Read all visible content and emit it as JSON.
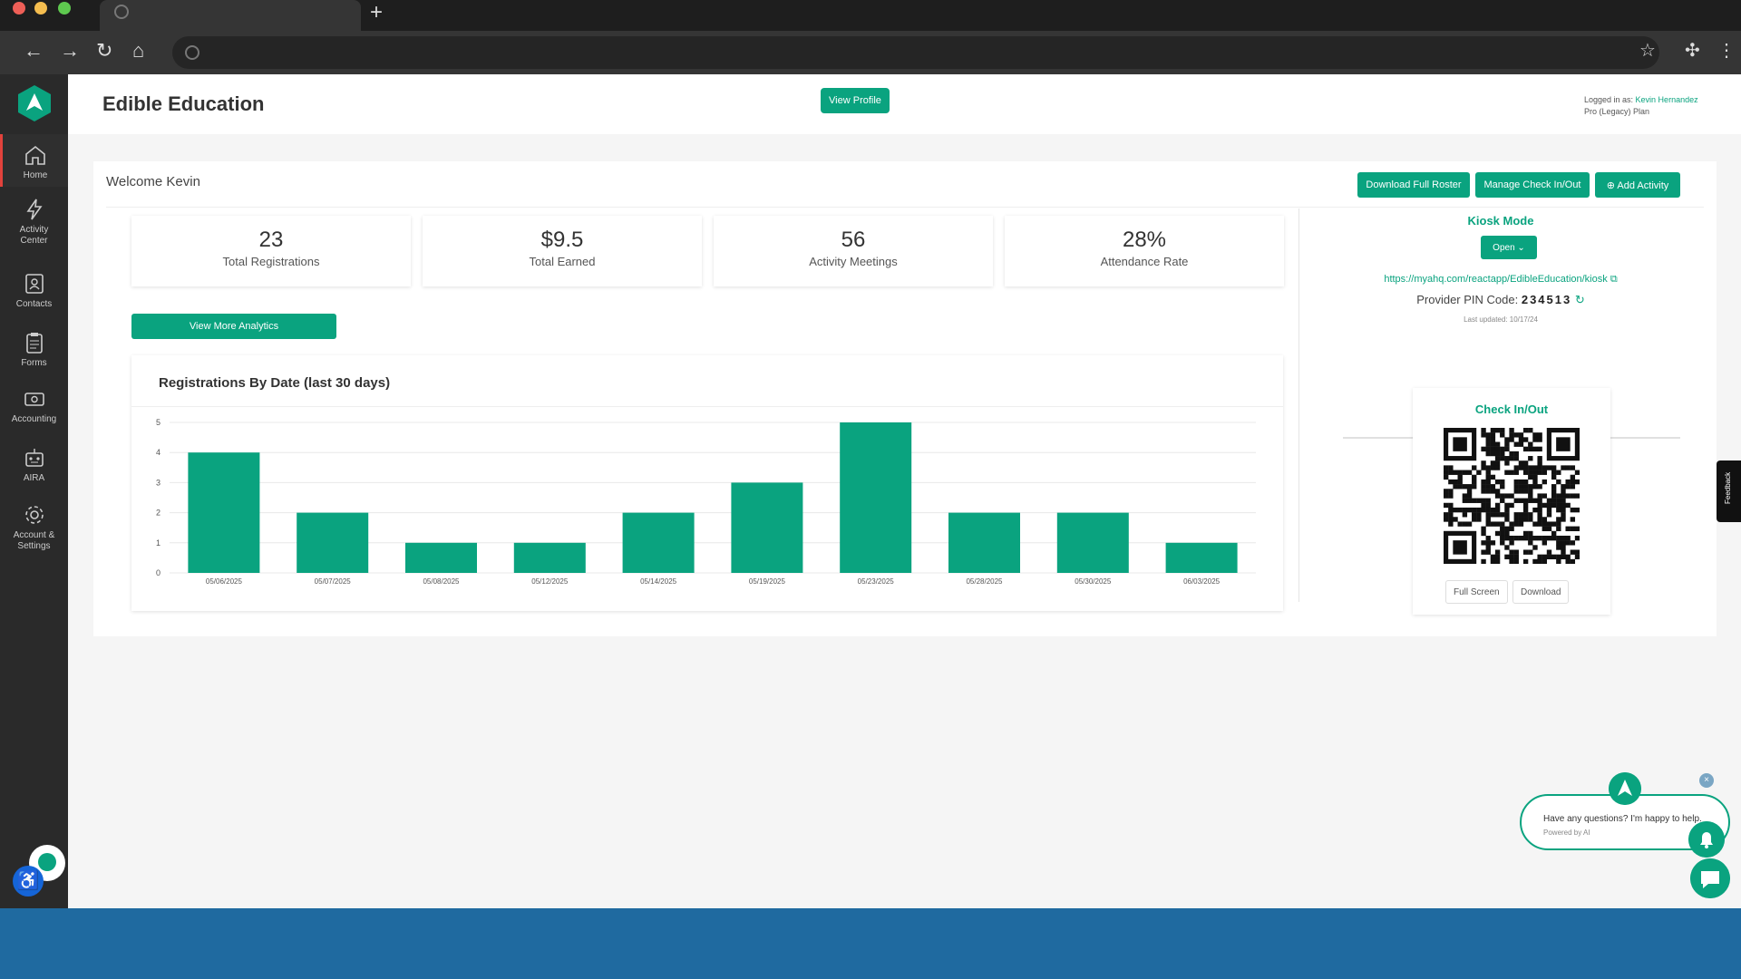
{
  "colors": {
    "accent": "#0aa37f",
    "sidebar": "#2a2a2a",
    "active_marker": "#e2423c"
  },
  "header": {
    "title": "Edible Education",
    "view_profile": "View Profile",
    "logged_in_prefix": "Logged in as: ",
    "user": "Kevin Hernandez",
    "plan": "Pro (Legacy) Plan"
  },
  "sidebar": {
    "items": [
      {
        "label": "Home",
        "icon": "home-icon"
      },
      {
        "label": "Activity Center",
        "icon": "bolt-icon"
      },
      {
        "label": "Contacts",
        "icon": "contacts-icon"
      },
      {
        "label": "Forms",
        "icon": "clipboard-icon"
      },
      {
        "label": "Accounting",
        "icon": "money-icon"
      },
      {
        "label": "AIRA",
        "icon": "robot-icon"
      },
      {
        "label": "Account & Settings",
        "icon": "gear-icon"
      }
    ]
  },
  "welcome": "Welcome Kevin",
  "actions": {
    "download_roster": "Download Full Roster",
    "manage_check": "Manage Check In/Out",
    "add_activity": "Add Activity"
  },
  "stats": [
    {
      "value": "23",
      "label": "Total Registrations"
    },
    {
      "value": "$9.5",
      "label": "Total Earned"
    },
    {
      "value": "56",
      "label": "Activity Meetings"
    },
    {
      "value": "28%",
      "label": "Attendance Rate"
    }
  ],
  "view_more": "View More Analytics",
  "chart_data": {
    "type": "bar",
    "title": "Registrations By Date (last 30 days)",
    "categories": [
      "05/06/2025",
      "05/07/2025",
      "05/08/2025",
      "05/12/2025",
      "05/14/2025",
      "05/19/2025",
      "05/23/2025",
      "05/28/2025",
      "05/30/2025",
      "06/03/2025"
    ],
    "values": [
      4,
      2,
      1,
      1,
      2,
      3,
      5,
      2,
      2,
      1
    ],
    "yticks": [
      "0",
      "1",
      "2",
      "3",
      "4",
      "5"
    ],
    "ylim": [
      0,
      5
    ],
    "grid": true,
    "color": "#0aa37f"
  },
  "kiosk": {
    "title": "Kiosk Mode",
    "open": "Open",
    "url": "https://myahq.com/reactapp/EdibleEducation/kiosk",
    "pin_label": "Provider PIN Code:",
    "pin": "234513",
    "updated": "Last updated: 10/17/24"
  },
  "checkin": {
    "title": "Check In/Out",
    "full_screen": "Full Screen",
    "download": "Download"
  },
  "feedback": "Feedback",
  "chat": {
    "message": "Have any questions? I'm happy to help.",
    "powered": "Powered by AI"
  }
}
